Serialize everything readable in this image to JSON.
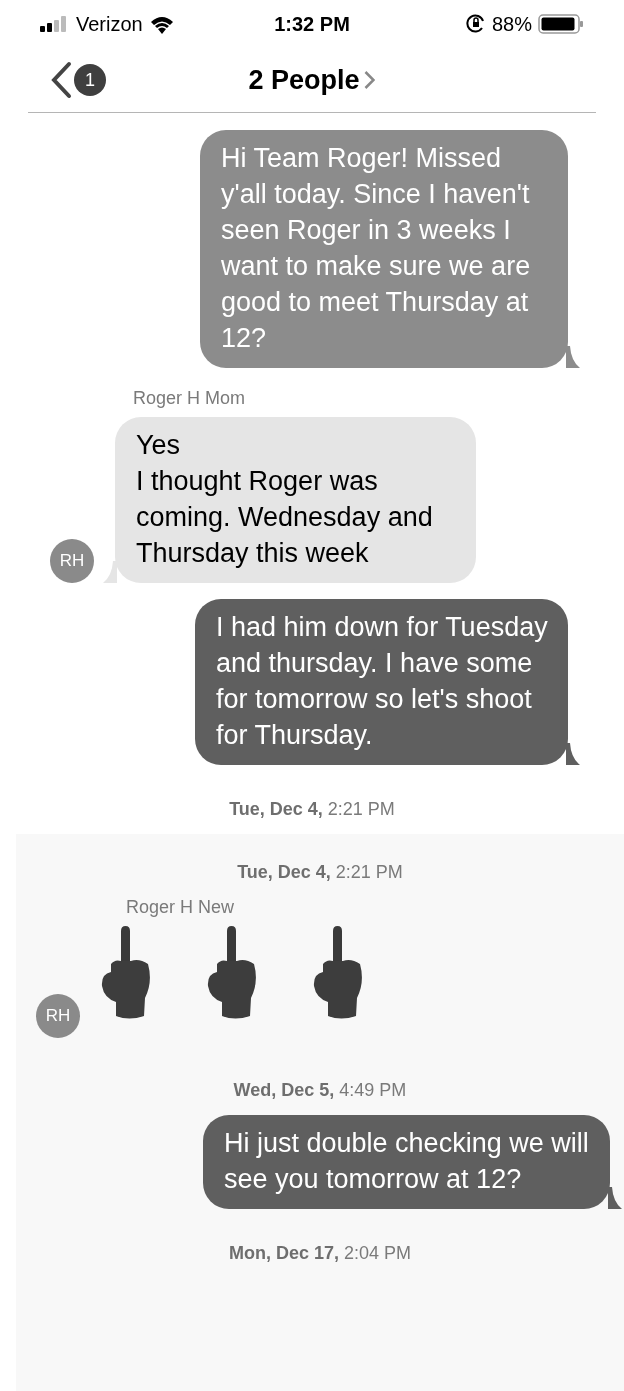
{
  "status_bar": {
    "carrier": "Verizon",
    "time": "1:32 PM",
    "battery": "88%"
  },
  "header": {
    "unread_badge": "1",
    "title": "2 People"
  },
  "thread": [
    {
      "kind": "outgoing",
      "text": "Hi Team Roger! Missed y'all today. Since I haven't seen Roger in 3 weeks I want to make sure we are good to meet Thursday at 12?",
      "color": "#8c8c8c"
    },
    {
      "kind": "sender",
      "text": "Roger H Mom"
    },
    {
      "kind": "incoming",
      "text": "Yes\nI thought Roger was coming. Wednesday and Thursday this week",
      "avatar": "RH"
    },
    {
      "kind": "outgoing",
      "text": "I had him down for Tuesday and thursday. I have some for tomorrow so let's shoot for Thursday.",
      "color": "#5f5f5f"
    },
    {
      "kind": "timestamp",
      "text": "**Tue, Dec 4,** 2:21 PM"
    }
  ],
  "overlay_thread": [
    {
      "kind": "timestamp",
      "text": "**Tue, Dec 4,** 2:21 PM"
    },
    {
      "kind": "sender",
      "text": "Roger H New"
    },
    {
      "kind": "emoji",
      "avatar": "RH",
      "emojis": [
        {
          "kind": "hand"
        },
        {
          "kind": "hand"
        },
        {
          "kind": "hand"
        }
      ]
    },
    {
      "kind": "timestamp",
      "text": "**Wed, Dec 5,** 4:49 PM"
    },
    {
      "kind": "outgoing",
      "text": "Hi just double checking we will see you tomorrow at 12?",
      "color": "#5f5f5f"
    },
    {
      "kind": "timestamp",
      "text": "**Mon, Dec 17,** 2:04 PM"
    }
  ]
}
